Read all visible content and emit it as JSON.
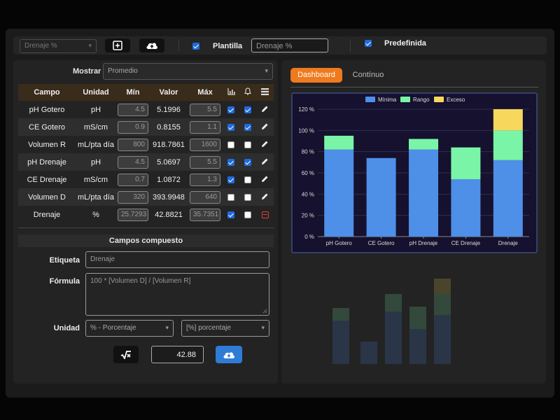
{
  "toolbar": {
    "preset_select": "Drenaje %",
    "plantilla_label": "Plantilla",
    "plantilla_checked": true,
    "name_value": "Drenaje %",
    "predefinida_label": "Predefinida",
    "predefinida_checked": true,
    "add_icon": "plus-square-icon",
    "upload_icon": "cloud-upload-icon"
  },
  "left": {
    "mostrar_label": "Mostrar",
    "mostrar_value": "Promedio",
    "columns": [
      "Campo",
      "Unidad",
      "Mín",
      "Valor",
      "Máx"
    ],
    "column_icons": [
      "chart-icon",
      "bell-icon",
      "list-icon"
    ],
    "rows": [
      {
        "campo": "pH Gotero",
        "unidad": "pH",
        "min": "4.5",
        "valor": "5.1996",
        "max": "5.5",
        "chart": true,
        "bell": true,
        "action": "edit"
      },
      {
        "campo": "CE Gotero",
        "unidad": "mS/cm",
        "min": "0.9",
        "valor": "0.8155",
        "max": "1.1",
        "chart": true,
        "bell": true,
        "action": "edit"
      },
      {
        "campo": "Volumen R",
        "unidad": "mL/pta día",
        "min": "800",
        "valor": "918.7861",
        "max": "1600",
        "chart": false,
        "bell": false,
        "action": "edit"
      },
      {
        "campo": "pH Drenaje",
        "unidad": "pH",
        "min": "4.5",
        "valor": "5.0697",
        "max": "5.5",
        "chart": true,
        "bell": true,
        "action": "edit"
      },
      {
        "campo": "CE Drenaje",
        "unidad": "mS/cm",
        "min": "0.7",
        "valor": "1.0872",
        "max": "1.3",
        "chart": true,
        "bell": false,
        "action": "edit"
      },
      {
        "campo": "Volumen D",
        "unidad": "mL/pta día",
        "min": "320",
        "valor": "393.9948",
        "max": "640",
        "chart": false,
        "bell": false,
        "action": "edit"
      },
      {
        "campo": "Drenaje",
        "unidad": "%",
        "min": "25.7293",
        "valor": "42.8821",
        "max": "35.7351",
        "chart": true,
        "bell": false,
        "action": "remove"
      }
    ],
    "compuesto": {
      "title": "Campos compuesto",
      "etiqueta_label": "Etiqueta",
      "etiqueta_value": "Drenaje",
      "formula_label": "Fórmula",
      "formula_value": "100 * [Volumen D] / [Volumen R]",
      "unidad_label": "Unidad",
      "unidad_select": "% - Porcentaje",
      "unidad_select2": "[%] porcentaje",
      "result_value": "42.88"
    }
  },
  "right": {
    "tabs": [
      "Dashboard",
      "Contínuo"
    ],
    "active_tab": "Dashboard"
  },
  "chart_data": {
    "type": "bar",
    "stacked": true,
    "categories": [
      "pH Gotero",
      "CE Gotero",
      "pH Drenaje",
      "CE Drenaje",
      "Drenaje"
    ],
    "series": [
      {
        "name": "Mínima",
        "color": "#4e8fe8",
        "values": [
          82,
          74,
          82,
          54,
          72
        ]
      },
      {
        "name": "Rango",
        "color": "#7af5a8",
        "values": [
          13,
          0,
          10,
          30,
          28
        ]
      },
      {
        "name": "Exceso",
        "color": "#f8d85c",
        "values": [
          0,
          0,
          0,
          0,
          20
        ]
      }
    ],
    "yticks": [
      "0 %",
      "20 %",
      "40 %",
      "60 %",
      "80 %",
      "100 %",
      "120 %"
    ],
    "ylim": [
      0,
      120
    ],
    "legend": "top",
    "grid": true
  }
}
